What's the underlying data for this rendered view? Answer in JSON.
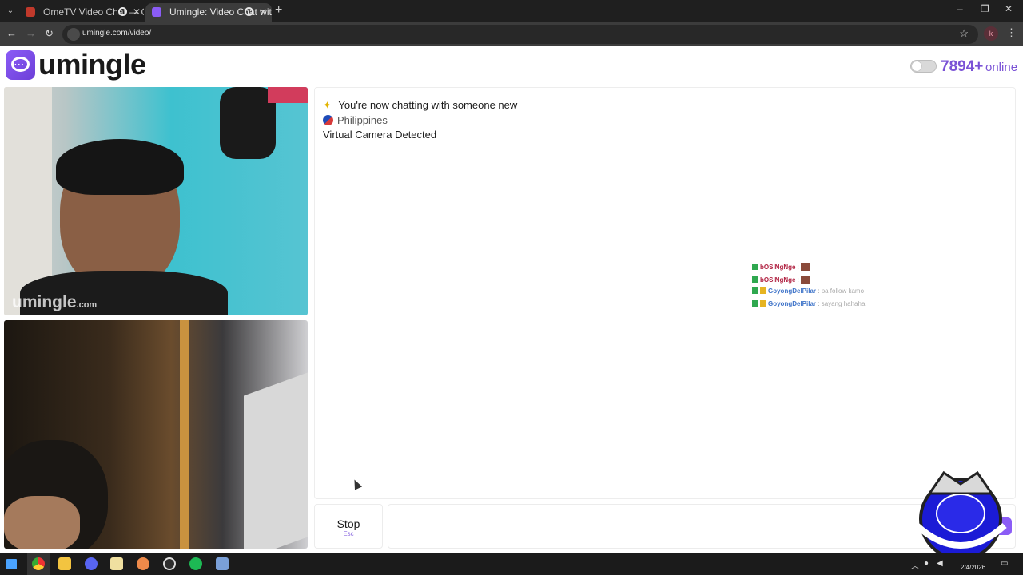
{
  "browser": {
    "tabs": [
      {
        "title": "OmeTV Video Chat — Ome",
        "active": false
      },
      {
        "title": "Umingle: Video Chat with St",
        "active": true
      }
    ],
    "new_tab": "+",
    "url": "umingle.com/video/",
    "profile_initial": "k",
    "window_controls": [
      "–",
      "❐",
      "✕"
    ]
  },
  "header": {
    "logo_text": "umingle",
    "online_count": "7894+",
    "online_label": "online"
  },
  "videos": {
    "watermark_main": "umingle",
    "watermark_suffix": ".com"
  },
  "chat": {
    "messages": [
      "You're now chatting with someone new",
      "Philippines",
      "Virtual Camera Detected"
    ]
  },
  "overlay_chat": [
    {
      "user": "bOSINgNge",
      "sep": " : ",
      "text": "",
      "color": "#b02040"
    },
    {
      "user": "bOSINgNge",
      "sep": " : ",
      "text": "",
      "color": "#b02040"
    },
    {
      "user": "GoyongDelPilar",
      "sep": " : ",
      "text": "pa follow kamo",
      "color": "#3f74c9"
    },
    {
      "user": "GoyongDelPilar",
      "sep": " : ",
      "text": "sayang hahaha",
      "color": "#3f74c9"
    }
  ],
  "controls": {
    "stop_label": "Stop",
    "stop_hint": "Esc"
  },
  "taskbar": {
    "date": "2/4/2026"
  },
  "colors": {
    "brand": "#7a52d6",
    "brand_gradient_start": "#8b5cf6"
  }
}
